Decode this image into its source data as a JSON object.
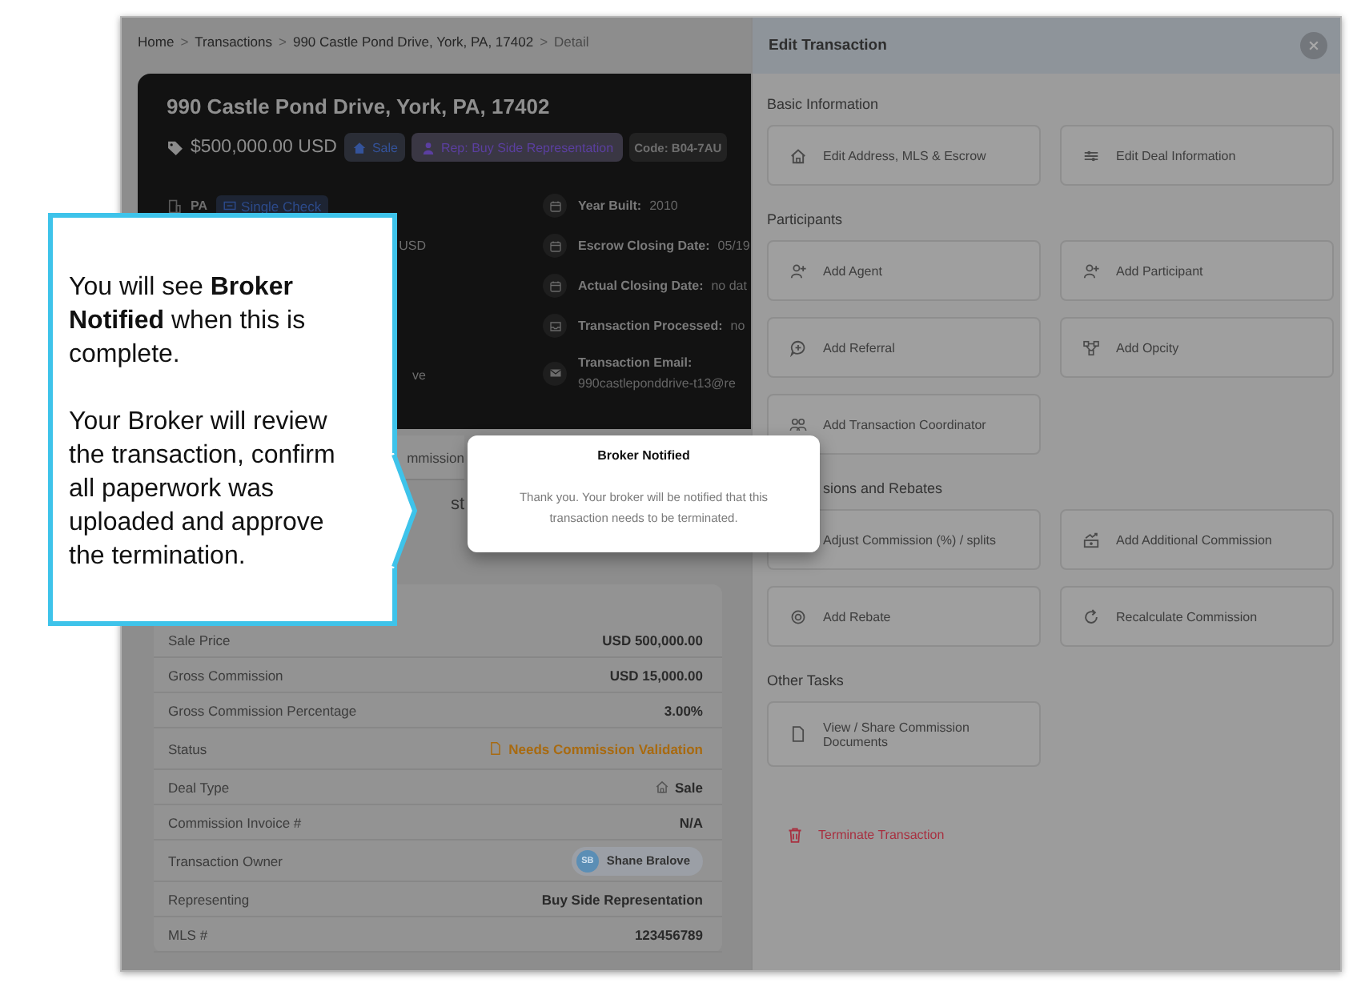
{
  "breadcrumb": {
    "items": [
      {
        "label": "Home",
        "current": false
      },
      {
        "label": "Transactions",
        "current": false
      },
      {
        "label": "990 Castle Pond Drive, York, PA, 17402",
        "current": false
      },
      {
        "label": "Detail",
        "current": true
      }
    ],
    "separators": [
      ">",
      ">",
      ">"
    ]
  },
  "property_card": {
    "title": "990 Castle Pond Drive, York, PA, 17402",
    "price": "$500,000.00 USD",
    "chips": [
      {
        "kind": "deal_type",
        "label": "Sale"
      },
      {
        "kind": "representation",
        "label": "Rep: Buy Side Representation"
      },
      {
        "kind": "code",
        "label": "Code: B04-7AU"
      }
    ],
    "details_left": [
      {
        "kind": "state",
        "label": "PA",
        "badge": "Single Check"
      },
      {
        "kind": "partial",
        "label": "USD"
      },
      {
        "kind": "partial",
        "label": "ve"
      }
    ],
    "details_right": [
      {
        "kind": "calendar",
        "label": "Year Built:",
        "value": "2010"
      },
      {
        "kind": "escrow",
        "label": "Escrow Closing Date:",
        "value": "05/19"
      },
      {
        "kind": "calendar_check",
        "label": "Actual Closing Date:",
        "value": "no dat"
      },
      {
        "kind": "processed",
        "label": "Transaction Processed:",
        "value": "no"
      },
      {
        "kind": "email",
        "label": "Transaction Email:",
        "value": "990castleponddrive-t13@re"
      }
    ]
  },
  "tab_strip": {
    "tab_fragment": "mmission",
    "field_fragment": "st"
  },
  "details_table": {
    "rows": [
      {
        "kind": "text",
        "label": "Sale Price",
        "value": "USD 500,000.00"
      },
      {
        "kind": "text",
        "label": "Gross Commission",
        "value": "USD 15,000.00"
      },
      {
        "kind": "text",
        "label": "Gross Commission Percentage",
        "value": "3.00%"
      },
      {
        "kind": "status",
        "label": "Status",
        "value": "Needs Commission Validation"
      },
      {
        "kind": "deal_type",
        "label": "Deal Type",
        "value": "Sale"
      },
      {
        "kind": "text",
        "label": "Commission Invoice #",
        "value": "N/A"
      },
      {
        "kind": "person",
        "label": "Transaction Owner",
        "value": "Shane Bralove",
        "initials": "SB"
      },
      {
        "kind": "text",
        "label": "Representing",
        "value": "Buy Side Representation"
      },
      {
        "kind": "text",
        "label": "MLS #",
        "value": "123456789"
      }
    ]
  },
  "drawer": {
    "title": "Edit Transaction",
    "sections": [
      {
        "title": "Basic Information",
        "covered": false,
        "actions": [
          {
            "kind": "address",
            "label": "Edit Address, MLS & Escrow"
          },
          {
            "kind": "deal",
            "label": "Edit Deal Information"
          }
        ]
      },
      {
        "title": "Participants",
        "covered": false,
        "actions": [
          {
            "kind": "agent",
            "label": "Add Agent"
          },
          {
            "kind": "participant",
            "label": "Add Participant"
          },
          {
            "kind": "referral",
            "label": "Add Referral"
          },
          {
            "kind": "opcity",
            "label": "Add Opcity"
          },
          {
            "kind": "coordinator",
            "label": "Add Transaction Coordinator"
          }
        ]
      },
      {
        "title": "sions and Rebates",
        "covered": true,
        "actions": [
          {
            "kind": "hidden",
            "label": "Adjust Commission (%) / splits"
          },
          {
            "kind": "additional",
            "label": "Add Additional Commission"
          },
          {
            "kind": "rebate",
            "label": "Add Rebate"
          },
          {
            "kind": "recalculate",
            "label": "Recalculate Commission"
          }
        ]
      },
      {
        "title": "Other Tasks",
        "covered": false,
        "actions": [
          {
            "kind": "document",
            "label": "View / Share Commission Documents"
          }
        ]
      }
    ],
    "danger_action": {
      "label": "Terminate Transaction"
    }
  },
  "dialog": {
    "title": "Broker Notified",
    "message": "Thank you. Your broker will be notified that this transaction needs to be terminated."
  },
  "callout": {
    "paragraphs": [
      "You will see **Broker Notified** when this is complete.",
      "Your Broker will review the transaction, confirm all paperwork was uploaded and approve the termination."
    ]
  }
}
